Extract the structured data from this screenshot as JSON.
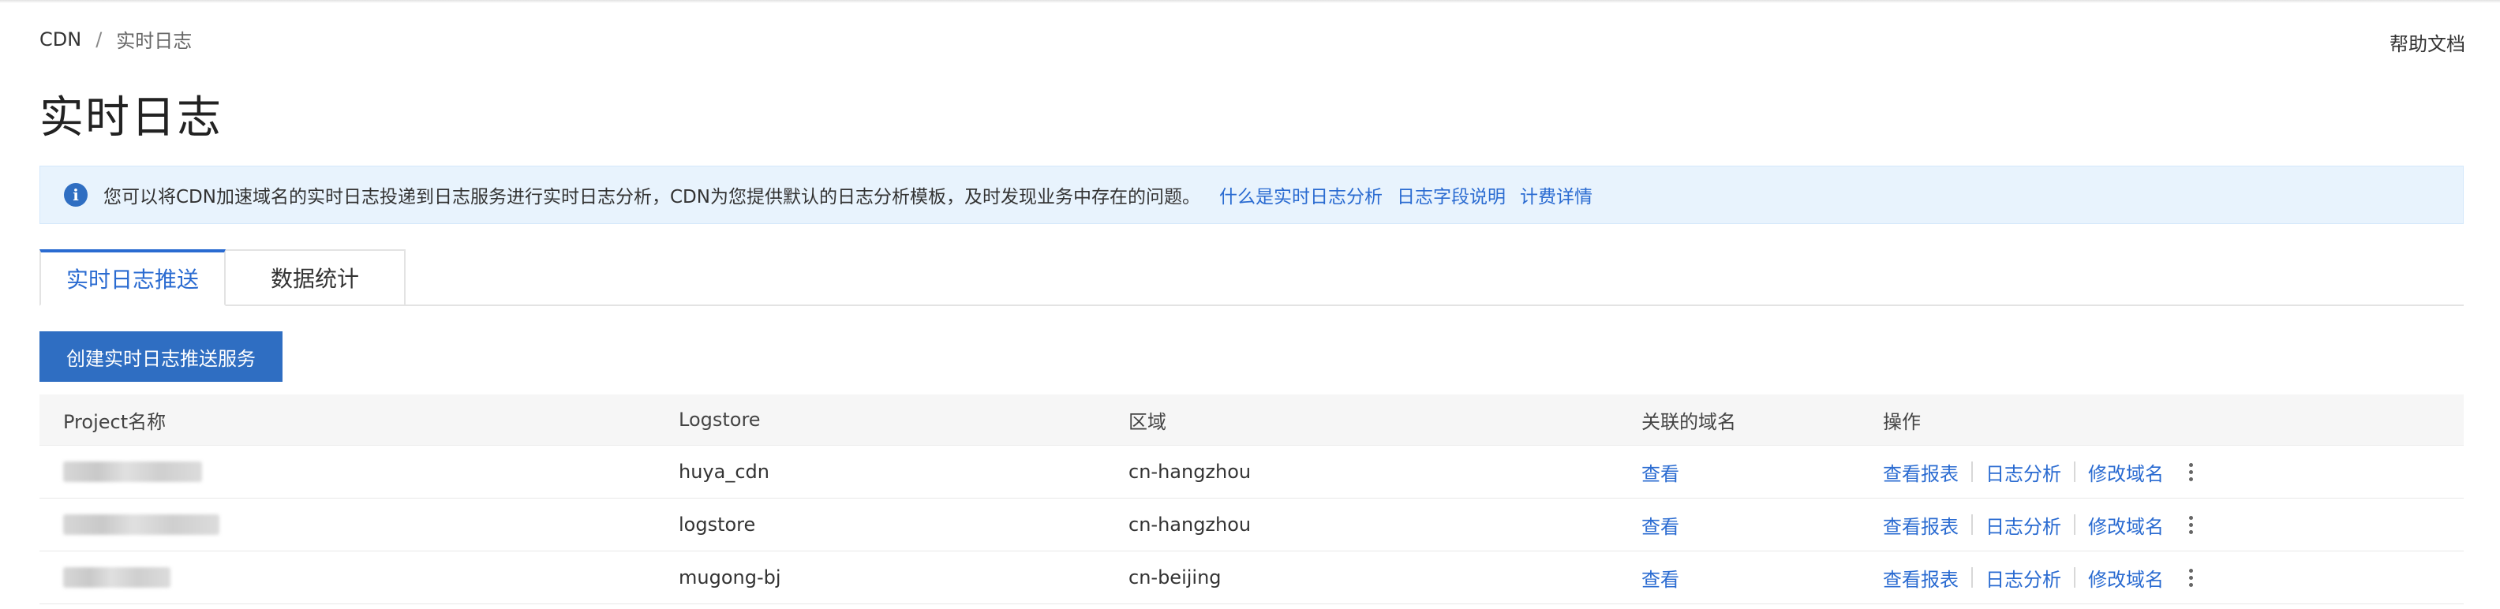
{
  "breadcrumb": {
    "root": "CDN",
    "separator": "/",
    "current": "实时日志"
  },
  "help_link": "帮助文档",
  "page_title": "实时日志",
  "notice": {
    "icon": "info-icon",
    "text": "您可以将CDN加速域名的实时日志投递到日志服务进行实时日志分析，CDN为您提供默认的日志分析模板，及时发现业务中存在的问题。",
    "links": [
      "什么是实时日志分析",
      "日志字段说明",
      "计费详情"
    ]
  },
  "tabs": [
    {
      "label": "实时日志推送",
      "active": true
    },
    {
      "label": "数据统计",
      "active": false
    }
  ],
  "create_button": "创建实时日志推送服务",
  "table": {
    "headers": [
      "Project名称",
      "Logstore",
      "区域",
      "关联的域名",
      "操作"
    ],
    "rows": [
      {
        "project": "",
        "logstore": "huya_cdn",
        "region": "cn-hangzhou",
        "domain_link": "查看"
      },
      {
        "project": "",
        "logstore": "logstore",
        "region": "cn-hangzhou",
        "domain_link": "查看"
      },
      {
        "project": "",
        "logstore": "mugong-bj",
        "region": "cn-beijing",
        "domain_link": "查看"
      }
    ],
    "actions": [
      "查看报表",
      "日志分析",
      "修改域名"
    ]
  },
  "colors": {
    "accent": "#2a6bd1",
    "button": "#2f6ec2",
    "notice_bg": "#e8f3fd"
  }
}
